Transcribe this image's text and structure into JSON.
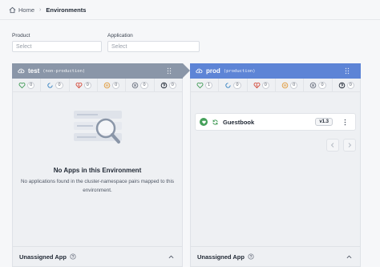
{
  "breadcrumb": {
    "home": "Home",
    "current": "Environments"
  },
  "filters": {
    "product": {
      "label": "Product",
      "placeholder": "Select"
    },
    "application": {
      "label": "Application",
      "placeholder": "Select"
    }
  },
  "colors": {
    "test_header": "#8a96a8",
    "prod_header": "#5d84d6"
  },
  "environments": [
    {
      "name": "test",
      "type": "(non-production)",
      "counts": [
        "0",
        "0",
        "0",
        "0",
        "0",
        "0"
      ],
      "empty_title": "No Apps in this Environment",
      "empty_desc": "No applications found in the cluster-namespace pairs mapped to this environment.",
      "footer": "Unassigned App"
    },
    {
      "name": "prod",
      "type": "(production)",
      "counts": [
        "1",
        "0",
        "0",
        "0",
        "0",
        "0"
      ],
      "app": {
        "name": "Guestbook",
        "version": "v1.3"
      },
      "footer": "Unassigned App"
    }
  ]
}
